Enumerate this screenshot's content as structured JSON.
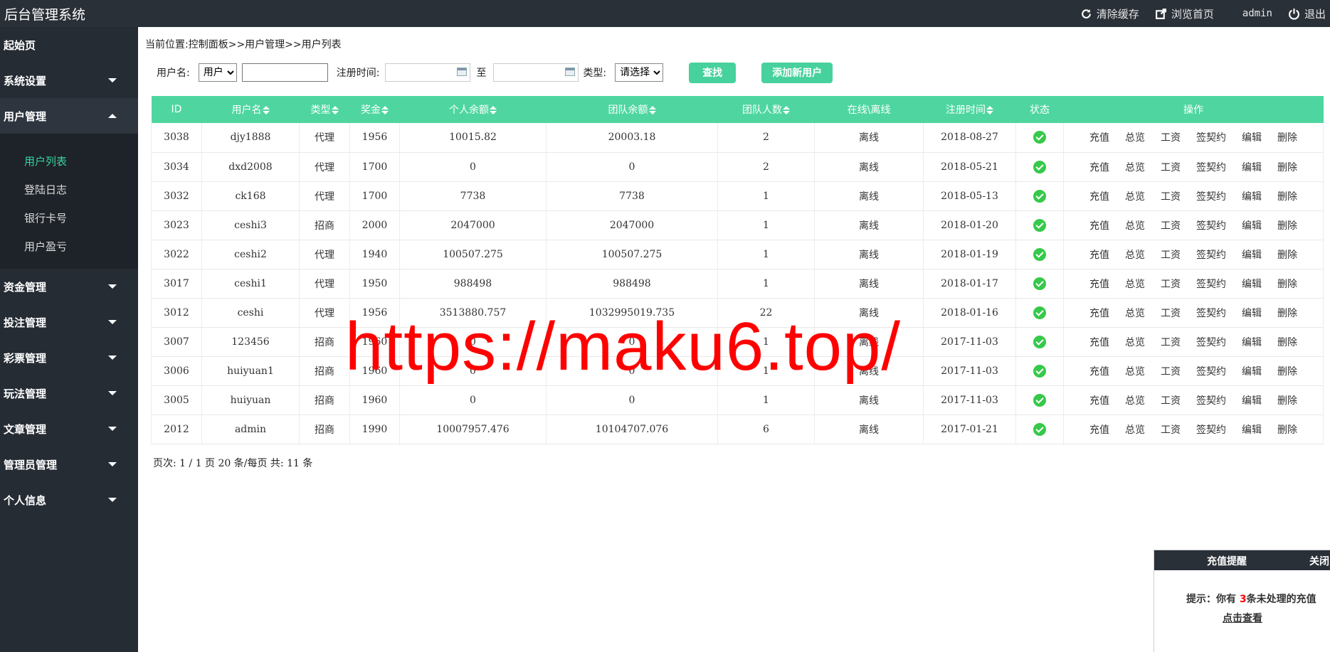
{
  "app": {
    "title": "后台管理系统"
  },
  "topbar": {
    "clear_cache": "清除缓存",
    "browse_home": "浏览首页",
    "user": "admin",
    "logout": "退出"
  },
  "sidebar": {
    "items": [
      {
        "label": "起始页"
      },
      {
        "label": "系统设置"
      },
      {
        "label": "用户管理"
      },
      {
        "label": "资金管理"
      },
      {
        "label": "投注管理"
      },
      {
        "label": "彩票管理"
      },
      {
        "label": "玩法管理"
      },
      {
        "label": "文章管理"
      },
      {
        "label": "管理员管理"
      },
      {
        "label": "个人信息"
      }
    ],
    "submenu": [
      {
        "label": "用户列表"
      },
      {
        "label": "登陆日志"
      },
      {
        "label": "银行卡号"
      },
      {
        "label": "用户盈亏"
      }
    ]
  },
  "breadcrumb": "当前位置:控制面板>>用户管理>>用户列表",
  "filters": {
    "username_label": "用户名:",
    "field_select": "用户",
    "username_value": "",
    "regtime_label": "注册时间:",
    "to_label": "至",
    "date_from": "",
    "date_to": "",
    "type_label": "类型:",
    "type_select": "请选择",
    "search_button": "查找",
    "add_button": "添加新用户"
  },
  "table": {
    "headers": [
      "ID",
      "用户名",
      "类型",
      "奖金",
      "个人余额",
      "团队余额",
      "团队人数",
      "在线\\离线",
      "注册时间",
      "状态",
      "操作"
    ],
    "actions": [
      "充值",
      "总览",
      "工资",
      "签契约",
      "编辑",
      "删除"
    ],
    "rows": [
      [
        "3038",
        "djy1888",
        "代理",
        "1956",
        "10015.82",
        "20003.18",
        "2",
        "离线",
        "2018-08-27"
      ],
      [
        "3034",
        "dxd2008",
        "代理",
        "1700",
        "0",
        "0",
        "2",
        "离线",
        "2018-05-21"
      ],
      [
        "3032",
        "ck168",
        "代理",
        "1700",
        "7738",
        "7738",
        "1",
        "离线",
        "2018-05-13"
      ],
      [
        "3023",
        "ceshi3",
        "招商",
        "2000",
        "2047000",
        "2047000",
        "1",
        "离线",
        "2018-01-20"
      ],
      [
        "3022",
        "ceshi2",
        "代理",
        "1940",
        "100507.275",
        "100507.275",
        "1",
        "离线",
        "2018-01-19"
      ],
      [
        "3017",
        "ceshi1",
        "代理",
        "1950",
        "988498",
        "988498",
        "1",
        "离线",
        "2018-01-17"
      ],
      [
        "3012",
        "ceshi",
        "代理",
        "1956",
        "3513880.757",
        "1032995019.735",
        "22",
        "离线",
        "2018-01-16"
      ],
      [
        "3007",
        "123456",
        "招商",
        "1960",
        "0",
        "0",
        "1",
        "离线",
        "2017-11-03"
      ],
      [
        "3006",
        "huiyuan1",
        "招商",
        "1960",
        "0",
        "0",
        "1",
        "离线",
        "2017-11-03"
      ],
      [
        "3005",
        "huiyuan",
        "招商",
        "1960",
        "0",
        "0",
        "1",
        "离线",
        "2017-11-03"
      ],
      [
        "2012",
        "admin",
        "招商",
        "1990",
        "10007957.476",
        "10104707.076",
        "6",
        "离线",
        "2017-01-21"
      ]
    ]
  },
  "pager": "页次: 1 / 1 页 20 条/每页 共: 11 条",
  "watermark": "https://maku6.top/",
  "popup": {
    "title": "充值提醒",
    "close": "关闭",
    "msg_prefix": "提示：你有",
    "count": "3",
    "msg_suffix": "条未处理的充值",
    "link": "点击查看"
  },
  "colors": {
    "accent": "#47d19c",
    "sidebar": "#262c34",
    "active": "#35d39d",
    "status_ok": "#36c94a",
    "watermark": "#ff0000"
  }
}
